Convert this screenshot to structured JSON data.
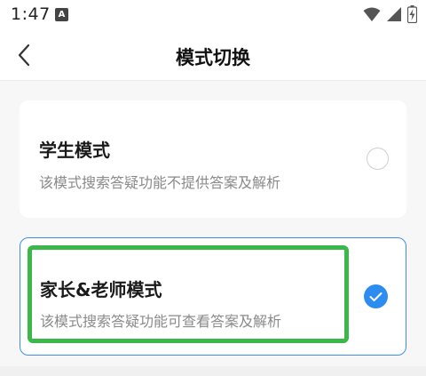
{
  "status_bar": {
    "time": "1:47",
    "notification_letter": "A"
  },
  "header": {
    "title": "模式切换"
  },
  "modes": [
    {
      "title": "学生模式",
      "description": "该模式搜索答疑功能不提供答案及解析",
      "selected": false
    },
    {
      "title": "家长&老师模式",
      "description": "该模式搜索答疑功能可查看答案及解析",
      "selected": true
    }
  ],
  "colors": {
    "accent": "#2d8cf0",
    "selected_border": "#3d8fe8",
    "highlight": "#3cb84a"
  }
}
